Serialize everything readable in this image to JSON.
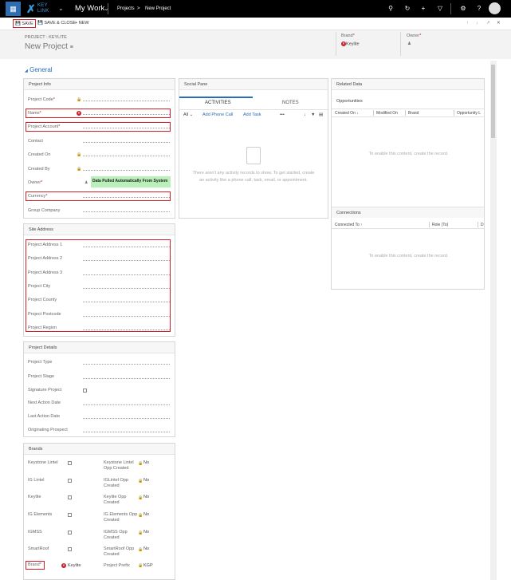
{
  "topbar": {
    "app_title": "My Work",
    "breadcrumb_1": "Projects",
    "breadcrumb_sep": ">",
    "breadcrumb_2": "New Project",
    "logo_line1": "KEY",
    "logo_line2": "LINK"
  },
  "toolbar": {
    "save": "SAVE",
    "save_close": "SAVE & CLOSE",
    "new": "NEW"
  },
  "header": {
    "entity": "PROJECT : KEYLITE",
    "record_name": "New Project",
    "brand_label": "Brand",
    "brand_value": "Keylite",
    "owner_label": "Owner"
  },
  "general": "General",
  "project_info": {
    "title": "Project Info",
    "fields": [
      {
        "label": "Project Code"
      },
      {
        "label": "Name"
      },
      {
        "label": "Project Account"
      },
      {
        "label": "Contact"
      },
      {
        "label": "Created On"
      },
      {
        "label": "Created By"
      },
      {
        "label": "Owner",
        "value": "Data Pulled Automatically From System"
      },
      {
        "label": "Currency"
      },
      {
        "label": "Group Company"
      }
    ]
  },
  "site_address": {
    "title": "Site Address",
    "fields": [
      {
        "label": "Project Address 1"
      },
      {
        "label": "Project Address 2"
      },
      {
        "label": "Project Address 3"
      },
      {
        "label": "Project City"
      },
      {
        "label": "Project County"
      },
      {
        "label": "Project Postcode"
      },
      {
        "label": "Project Region"
      }
    ]
  },
  "project_details": {
    "title": "Project Details",
    "fields": [
      {
        "label": "Project Type"
      },
      {
        "label": "Project Stage"
      },
      {
        "label": "Signature Project"
      },
      {
        "label": "Next Action Date"
      },
      {
        "label": "Last Action Date"
      },
      {
        "label": "Originating Prospect"
      }
    ]
  },
  "brands": {
    "title": "Brands",
    "rows": [
      {
        "left": "Keystone Lintel",
        "right": "Keystone Lintel Opp Created",
        "value": "No"
      },
      {
        "left": "IG Lintel",
        "right": "IGLintel Opp Created",
        "value": "No"
      },
      {
        "left": "Keylite",
        "right": "Keylite Opp Created",
        "value": "No"
      },
      {
        "left": "IG Elements",
        "right": "IG Elements Opp Created",
        "value": "No"
      },
      {
        "left": "IGMSS",
        "right": "IGMSS Opp Created",
        "value": "No"
      },
      {
        "left": "SmartRoof",
        "right": "SmartRoof Opp Created",
        "value": "No"
      }
    ],
    "brand_label": "Brand",
    "brand_value": "Keylite",
    "prefix_label": "Project Prefix",
    "prefix_value": "KGP"
  },
  "social": {
    "title": "Social Pane",
    "tab_activities": "ACTIVITIES",
    "tab_notes": "NOTES",
    "filter": "All",
    "add_phone": "Add Phone Call",
    "add_task": "Add Task",
    "more": "•••",
    "empty": "There aren't any activity records to show. To get started, create an activity like a phone call, task, email, or appointment."
  },
  "related": {
    "title": "Related Data",
    "opportunities": "Opportunities",
    "opp_cols": [
      "Created On",
      "Modified On",
      "Brand",
      "Opportunity L"
    ],
    "opp_empty": "To enable this content, create the record.",
    "connections": "Connections",
    "conn_cols": [
      "Connected To",
      "Role (To)",
      "D"
    ],
    "conn_empty": "To enable this content, create the record."
  }
}
